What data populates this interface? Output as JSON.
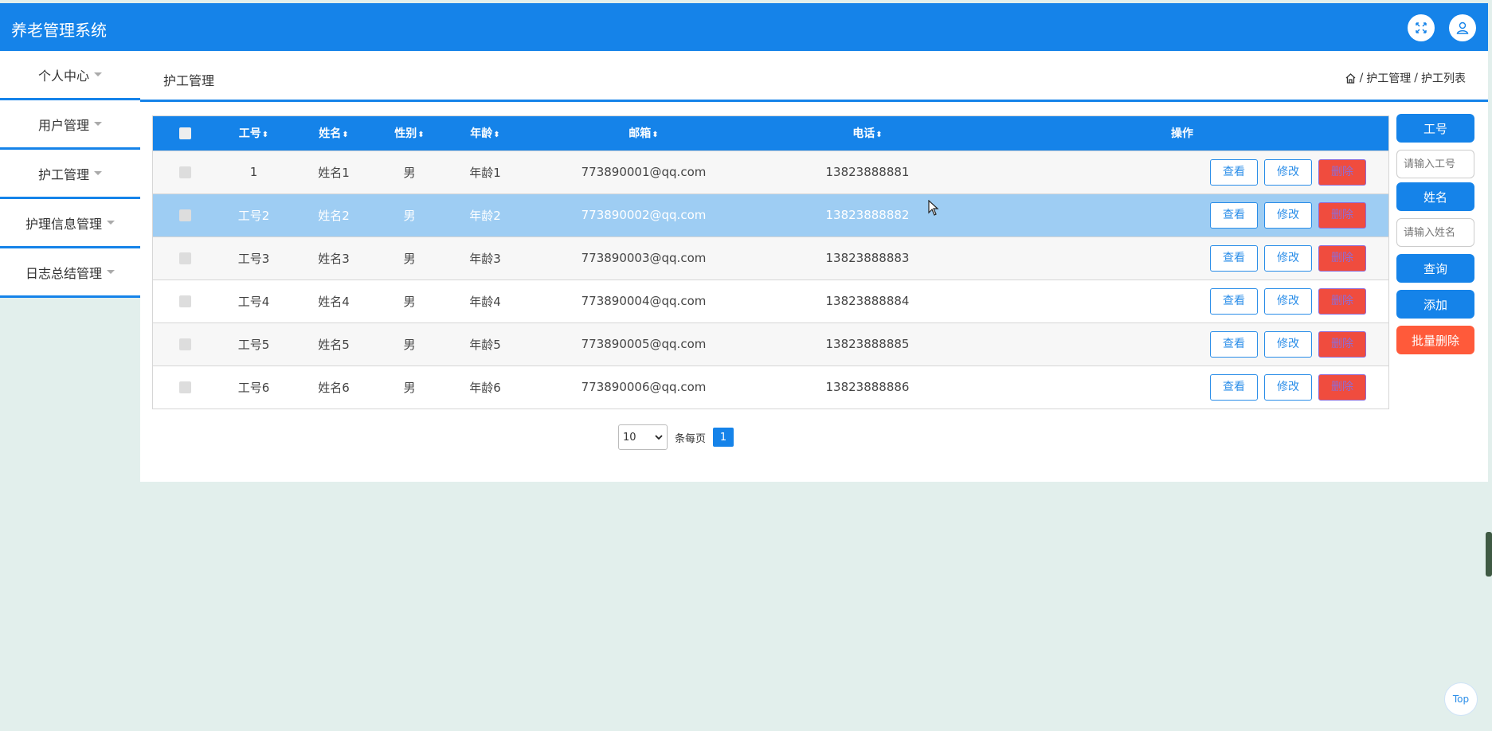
{
  "app": {
    "title": "养老管理系统"
  },
  "sidebar": {
    "items": [
      {
        "label": "个人中心"
      },
      {
        "label": "用户管理"
      },
      {
        "label": "护工管理"
      },
      {
        "label": "护理信息管理"
      },
      {
        "label": "日志总结管理"
      }
    ]
  },
  "header": {
    "page_title": "护工管理",
    "breadcrumb": [
      "护工管理",
      "护工列表"
    ],
    "breadcrumb_sep": "/"
  },
  "table": {
    "columns": [
      "工号",
      "姓名",
      "性别",
      "年龄",
      "邮箱",
      "电话",
      "操作"
    ],
    "sort_glyph": "⬍",
    "rows": [
      {
        "id": "1",
        "name": "姓名1",
        "gender": "男",
        "age": "年龄1",
        "email": "773890001@qq.com",
        "phone": "13823888881"
      },
      {
        "id": "工号2",
        "name": "姓名2",
        "gender": "男",
        "age": "年龄2",
        "email": "773890002@qq.com",
        "phone": "13823888882"
      },
      {
        "id": "工号3",
        "name": "姓名3",
        "gender": "男",
        "age": "年龄3",
        "email": "773890003@qq.com",
        "phone": "13823888883"
      },
      {
        "id": "工号4",
        "name": "姓名4",
        "gender": "男",
        "age": "年龄4",
        "email": "773890004@qq.com",
        "phone": "13823888884"
      },
      {
        "id": "工号5",
        "name": "姓名5",
        "gender": "男",
        "age": "年龄5",
        "email": "773890005@qq.com",
        "phone": "13823888885"
      },
      {
        "id": "工号6",
        "name": "姓名6",
        "gender": "男",
        "age": "年龄6",
        "email": "773890006@qq.com",
        "phone": "13823888886"
      }
    ],
    "actions": {
      "view": "查看",
      "edit": "修改",
      "delete": "删除"
    }
  },
  "pagination": {
    "page_size": "10",
    "per_page_label": "条每页",
    "current_page": "1"
  },
  "search": {
    "id_label": "工号",
    "id_placeholder": "请输入工号",
    "name_label": "姓名",
    "name_placeholder": "请输入姓名",
    "query_button": "查询",
    "add_button": "添加",
    "batch_delete_button": "批量删除"
  },
  "back_to_top": "Top",
  "colors": {
    "primary": "#1583e9",
    "danger": "#ff5a3a",
    "selected_row": "#9ecdf3",
    "background": "#e2efec"
  }
}
